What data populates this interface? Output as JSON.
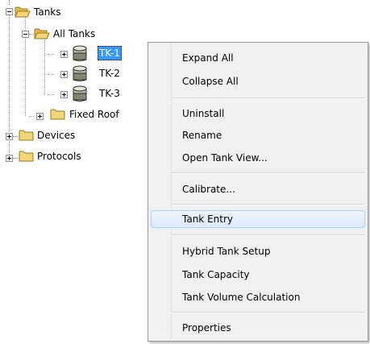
{
  "tree": {
    "tanks_label": "Tanks",
    "all_tanks_label": "All Tanks",
    "tk1_label": "TK-1",
    "tk2_label": "TK-2",
    "tk3_label": "TK-3",
    "fixed_roof_label": "Fixed Roof",
    "devices_label": "Devices",
    "protocols_label": "Protocols",
    "selected": "TK-1"
  },
  "context_menu": {
    "expand_all": "Expand All",
    "collapse_all": "Collapse All",
    "uninstall": "Uninstall",
    "rename": "Rename",
    "open_tank_view": "Open Tank View...",
    "calibrate": "Calibrate...",
    "tank_entry": "Tank Entry",
    "hybrid_tank_setup": "Hybrid Tank Setup",
    "tank_capacity": "Tank Capacity",
    "tank_volume_calculation": "Tank Volume Calculation",
    "properties": "Properties",
    "highlighted": "Tank Entry"
  },
  "colors": {
    "selection": "#3399ff",
    "folder": "#f1d779",
    "menu_background": "#f0f0f0",
    "menu_highlight": "#dcebfc"
  },
  "icons": [
    "expander-minus-icon",
    "expander-plus-icon",
    "folder-open-icon",
    "folder-closed-icon",
    "tank-icon"
  ]
}
